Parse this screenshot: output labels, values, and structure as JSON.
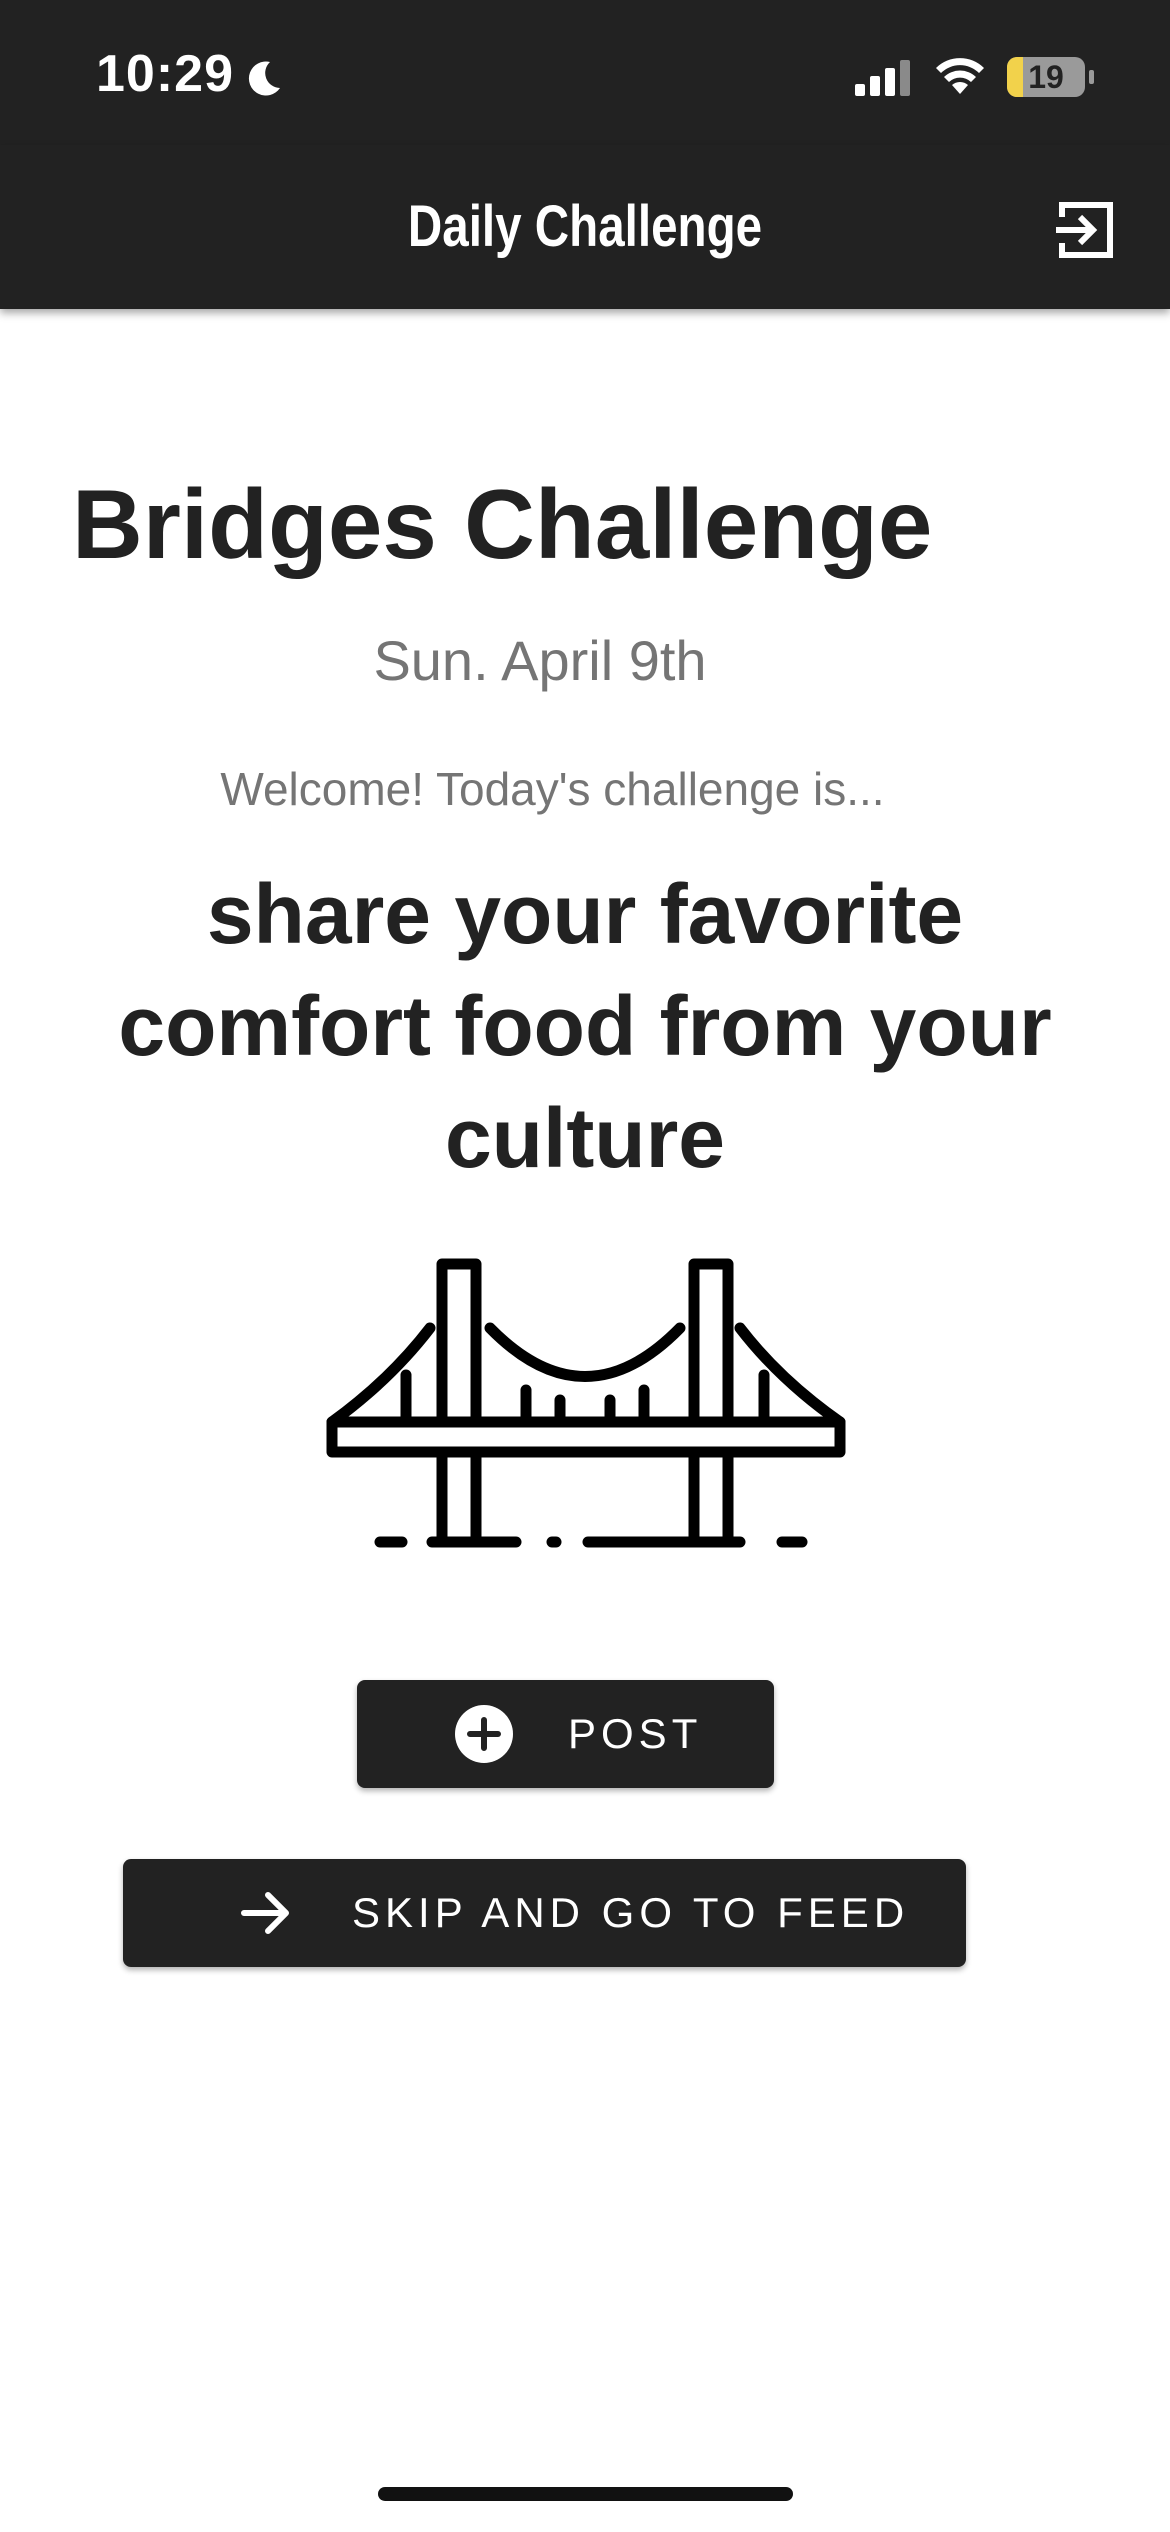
{
  "status_bar": {
    "time": "10:29",
    "battery_level": "19",
    "icons": [
      "moon-icon",
      "signal-icon",
      "wifi-icon",
      "battery-icon"
    ]
  },
  "header": {
    "title": "Daily Challenge",
    "action_icon": "logout-icon"
  },
  "challenge": {
    "title": "Bridges Challenge",
    "date": "Sun. April 9th",
    "welcome": "Welcome! Today's challenge is...",
    "prompt": "share your favorite comfort food from your culture",
    "illustration": "bridge-icon"
  },
  "actions": {
    "post_label": "POST",
    "post_icon": "plus-circle-icon",
    "skip_label": "SKIP AND GO TO FEED",
    "skip_icon": "arrow-right-icon"
  },
  "colors": {
    "bar_background": "#222222",
    "text_dark": "#222222",
    "text_muted": "#757575",
    "battery_fill": "#f2d24b"
  }
}
